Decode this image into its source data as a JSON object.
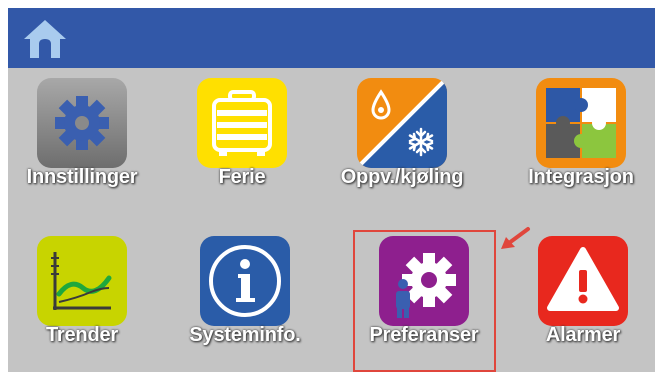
{
  "header": {
    "home_icon": "home-icon",
    "color": "#3258a8"
  },
  "tiles": [
    {
      "label": "Innstillinger",
      "icon": "gear-icon",
      "color": "#8a8a8a"
    },
    {
      "label": "Ferie",
      "icon": "suitcase-icon",
      "color": "#ffe000"
    },
    {
      "label": "Oppv./kjøling",
      "icon": "heating-cooling-icon",
      "color": "#f28c10"
    },
    {
      "label": "Integrasjon",
      "icon": "puzzle-icon",
      "color": "#f28c10"
    },
    {
      "label": "Trender",
      "icon": "trend-graph-icon",
      "color": "#c8d400"
    },
    {
      "label": "Systeminfo.",
      "icon": "info-icon",
      "color": "#2a5ca8"
    },
    {
      "label": "Preferanser",
      "icon": "user-gear-icon",
      "color": "#8e1f8e",
      "highlighted": true
    },
    {
      "label": "Alarmer",
      "icon": "warning-icon",
      "color": "#e8281e"
    }
  ],
  "annotation": {
    "color": "#e0463c",
    "arrow_icon": "arrow-pointer-icon"
  }
}
